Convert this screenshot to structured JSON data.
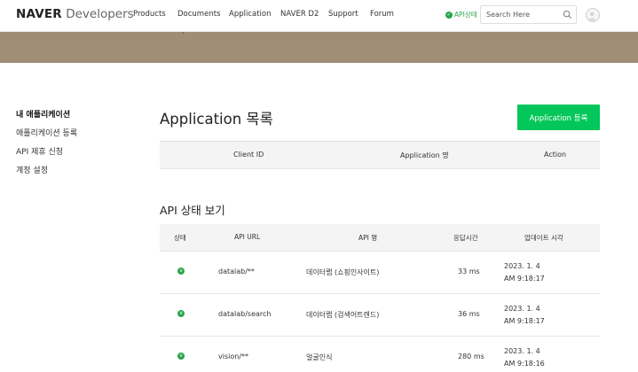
{
  "header": {
    "logo_brand": "NAVER",
    "logo_product": "Developers",
    "nav": [
      "Products",
      "Documents",
      "Application",
      "NAVER D2",
      "Support",
      "Forum"
    ],
    "api_status_label": "API상태",
    "search_placeholder": "Search Here",
    "accent_color": "#03c75a",
    "status_color": "#2aa54a"
  },
  "banner": {
    "color": "#a08d76"
  },
  "sidebar": {
    "items": [
      {
        "label": "내 애플리케이션",
        "active": true
      },
      {
        "label": "애플리케이션 등록",
        "active": false
      },
      {
        "label": "API 제휴 신청",
        "active": false
      },
      {
        "label": "계정 설정",
        "active": false
      }
    ]
  },
  "applications": {
    "title": "Application 목록",
    "register_label": "Application 등록",
    "columns": [
      "Client ID",
      "Application 명",
      "Action"
    ],
    "rows": []
  },
  "api_status": {
    "title": "API 상태 보기",
    "columns": [
      "상태",
      "API URL",
      "API 명",
      "응답시간",
      "업데이트 시각"
    ],
    "rows": [
      {
        "status_icon": "v",
        "url": "datalab/**",
        "name": "데이터랩 (쇼핑인사이트)",
        "response": "33 ms",
        "date": "2023. 1. 4",
        "time": "AM 9:18:17"
      },
      {
        "status_icon": "v",
        "url": "datalab/search",
        "name": "데이터랩 (검색어트렌드)",
        "response": "36 ms",
        "date": "2023. 1. 4",
        "time": "AM 9:18:17"
      },
      {
        "status_icon": "v",
        "url": "vision/**",
        "name": "얼굴인식",
        "response": "280 ms",
        "date": "2023. 1. 4",
        "time": "AM 9:18:16"
      }
    ]
  }
}
